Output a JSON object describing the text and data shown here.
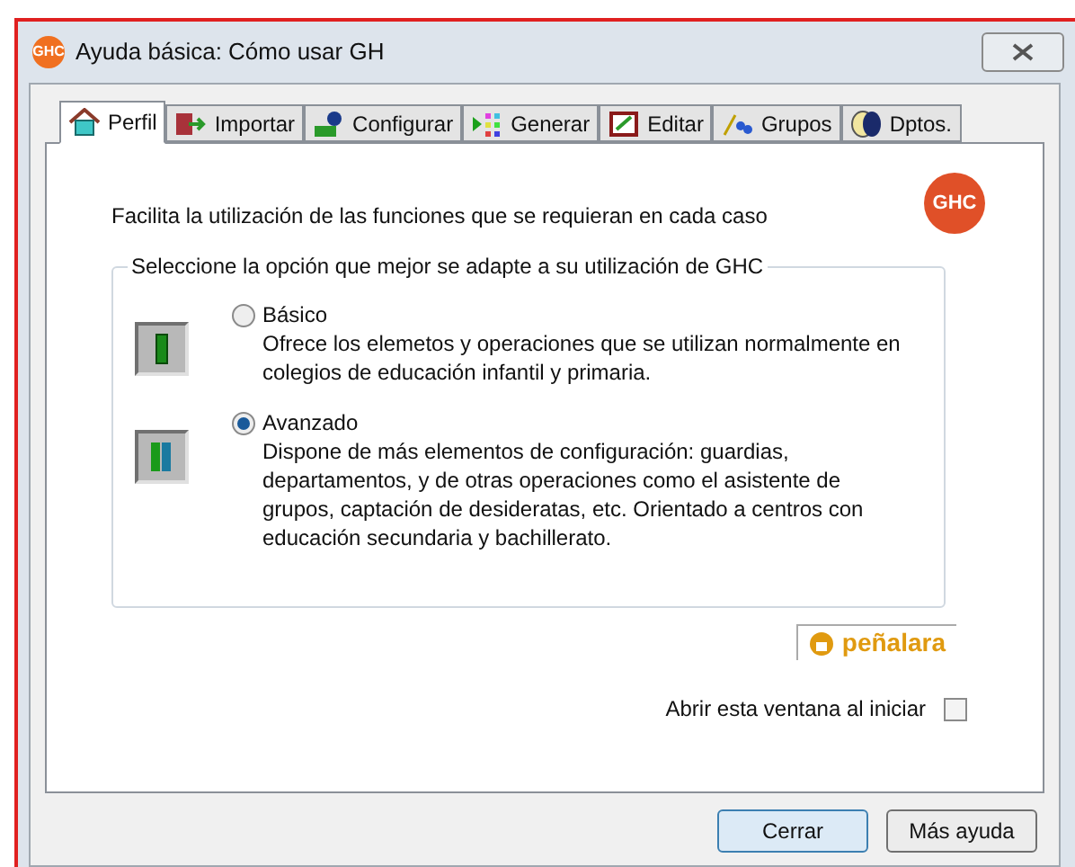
{
  "window": {
    "icon_text": "GHC",
    "title": "Ayuda básica: Cómo usar GH"
  },
  "tabs": [
    {
      "label": "Perfil",
      "selected": true
    },
    {
      "label": "Importar",
      "selected": false
    },
    {
      "label": "Configurar",
      "selected": false
    },
    {
      "label": "Generar",
      "selected": false
    },
    {
      "label": "Editar",
      "selected": false
    },
    {
      "label": "Grupos",
      "selected": false
    },
    {
      "label": "Dptos.",
      "selected": false
    }
  ],
  "intro": "Facilita la utilización de las funciones que se requieran en cada caso",
  "logo_text": "GHC",
  "group": {
    "title": "Seleccione la opción que mejor se adapte a su utilización de GHC",
    "options": [
      {
        "label": "Básico",
        "selected": false,
        "description": "Ofrece los elemetos y operaciones que se utilizan normalmente en colegios de educación infantil y primaria."
      },
      {
        "label": "Avanzado",
        "selected": true,
        "description": "Dispone de más elementos de configuración: guardias, departamentos, y de otras operaciones como el asistente de grupos, captación de desideratas, etc. Orientado a centros con educación secundaria y bachillerato."
      }
    ]
  },
  "brand": "peñalara",
  "startup": {
    "label": "Abrir esta ventana al iniciar",
    "checked": false
  },
  "buttons": [
    {
      "label": "Cerrar",
      "default": true
    },
    {
      "label": "Más ayuda",
      "default": false
    }
  ]
}
